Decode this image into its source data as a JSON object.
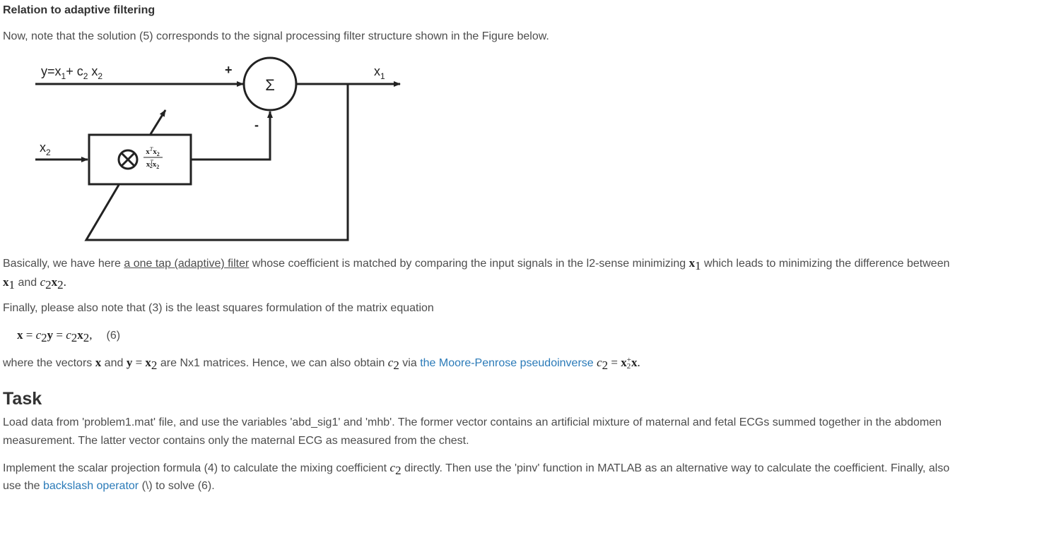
{
  "section": {
    "title": "Relation to adaptive filtering",
    "intro": "Now, note that the solution (5) corresponds to the signal processing filter structure shown in the Figure below."
  },
  "figure": {
    "input_y_label": "y=x",
    "input_y_sub1": "1",
    "input_y_plus": "+ c",
    "input_y_sub2": "2",
    "input_y_x": " x",
    "input_y_sub3": "2",
    "input_x2_label": "x",
    "input_x2_sub": "2",
    "output_label": "x",
    "output_sub": "1",
    "plus_sign": "+",
    "minus_sign": "-",
    "sum_symbol": "Σ",
    "frac_num": "x",
    "frac_num_sup": "T",
    "frac_num_x": "x",
    "frac_num_sub": "2",
    "frac_den": "x",
    "frac_den_sup": "T",
    "frac_den_sub1": "2",
    "frac_den_x": "x",
    "frac_den_sub2": "2"
  },
  "para1": {
    "t1": "Basically, we have here ",
    "link": "a one tap (adaptive) filter",
    "t2": " whose coefficient is matched by comparing the input signals in the l2-sense minimizing ",
    "x1": "x",
    "x1_sub": "1",
    "t3": " which leads to minimizing the difference between",
    "line2_x1": "x",
    "line2_x1_sub": "1",
    "line2_and": " and ",
    "line2_c": "c",
    "line2_c_sub": "2",
    "line2_x": "x",
    "line2_x_sub": "2",
    "line2_end": "."
  },
  "para2": {
    "text": "Finally, please also note that (3) is the least squares formulation of the matrix equation"
  },
  "equation6": {
    "x": "x",
    "eq1": " = ",
    "c": "c",
    "c_sub": "2",
    "y": "y",
    "eq2": " = ",
    "c2": "c",
    "c2_sub": "2",
    "x2": "x",
    "x2_sub": "2",
    "comma": ",",
    "num": "(6)"
  },
  "para3": {
    "t1": "where the vectors ",
    "x": "x",
    "and": " and ",
    "y": "y",
    "eq": " = ",
    "x2": "x",
    "x2_sub": "2",
    "t2": " are Nx1 matrices. Hence, we can also obtain ",
    "c": "c",
    "c_sub": "2",
    "via": " via ",
    "link": "the Moore-Penrose pseudoinverse",
    "c2": "c",
    "c2_sub": "2",
    "eq2": " = ",
    "xp": "x",
    "xp_sup": "+",
    "xp_sub": "2",
    "xend": "x",
    "end": "."
  },
  "task": {
    "title": "Task",
    "p1_line1": "Load data from 'problem1.mat' file, and use the variables 'abd_sig1' and 'mhb'. The former vector contains an artificial mixture of maternal and fetal ECGs summed together in the abdomen",
    "p1_line2": "measurement. The latter vector contains only the maternal ECG as measured from the chest.",
    "p2_t1": "Implement the scalar projection formula (4) to calculate the mixing coefficient ",
    "p2_c": "c",
    "p2_c_sub": "2",
    "p2_t2": " directly. Then use the 'pinv' function in MATLAB as an alternative way to calculate the coefficient. Finally, also",
    "p2_line2_t1": "use the ",
    "p2_link": "backslash operator",
    "p2_line2_t2": " (\\) to solve (6)."
  }
}
